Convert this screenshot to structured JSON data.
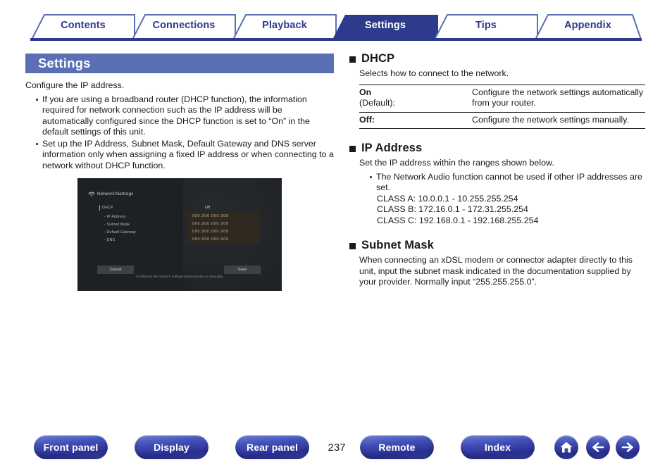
{
  "tabs": [
    {
      "label": "Contents",
      "active": false
    },
    {
      "label": "Connections",
      "active": false
    },
    {
      "label": "Playback",
      "active": false
    },
    {
      "label": "Settings",
      "active": true
    },
    {
      "label": "Tips",
      "active": false
    },
    {
      "label": "Appendix",
      "active": false
    }
  ],
  "left": {
    "banner_title": "Settings",
    "lead": "Configure the IP address.",
    "bullets": [
      "If you are using a broadband router (DHCP function), the information required for network connection such as the IP address will be automatically configured since the DHCP function is set to “On” in the default settings of this unit.",
      "Set up the IP Address, Subnet Mask, Default Gateway and DNS server information only when assigning a fixed IP address or when connecting to a network without DHCP function."
    ]
  },
  "device_screen": {
    "title": "Network/Settings",
    "wifi_icon": "wifi-icon",
    "rows": [
      {
        "label": "DHCP",
        "value": "Off",
        "type": "plain"
      },
      {
        "label": "- IP Address",
        "value": "000.000.000.000",
        "type": "field"
      },
      {
        "label": "- Subnet Mask",
        "value": "000.000.000.000",
        "type": "field"
      },
      {
        "label": "- Default Gateway",
        "value": "000.000.000.000",
        "type": "field"
      },
      {
        "label": "- DNS",
        "value": "000.000.000.000",
        "type": "field"
      }
    ],
    "cancel_button": "Cancel",
    "save_button": "Save",
    "caption": "Configures the network settings automatically or manually."
  },
  "right": {
    "dhcp": {
      "title": "DHCP",
      "intro": "Selects how to connect to the network.",
      "table": [
        {
          "key": "On",
          "key_sub": "(Default):",
          "value": "Configure the network settings automatically from your router."
        },
        {
          "key": "Off:",
          "key_sub": "",
          "value": "Configure the network settings manually."
        }
      ]
    },
    "ip_address": {
      "title": "IP Address",
      "intro": "Set the IP address within the ranges shown below.",
      "bullet": "The Network Audio function cannot be used if other IP addresses are set.",
      "classes": [
        "CLASS A: 10.0.0.1 - 10.255.255.254",
        "CLASS B: 172.16.0.1 - 172.31.255.254",
        "CLASS C: 192.168.0.1 - 192.168.255.254"
      ]
    },
    "subnet_mask": {
      "title": "Subnet Mask",
      "body": "When connecting an xDSL modem or connector adapter directly to this unit, input the subnet mask indicated in the documentation supplied by your provider. Normally input “255.255.255.0”."
    }
  },
  "footer": {
    "buttons": [
      {
        "label": "Front panel"
      },
      {
        "label": "Display"
      },
      {
        "label": "Rear panel"
      },
      {
        "label": "Remote"
      },
      {
        "label": "Index"
      }
    ],
    "page_number": "237",
    "icons": [
      {
        "name": "home-icon"
      },
      {
        "name": "arrow-left-icon"
      },
      {
        "name": "arrow-right-icon"
      }
    ]
  },
  "colors": {
    "tab_active_bg": "#2e3a8c",
    "tab_border": "#5b6fb5",
    "banner_bg": "#5b6fb5",
    "device_bg": "#1e2124",
    "device_field": "#30291f"
  }
}
